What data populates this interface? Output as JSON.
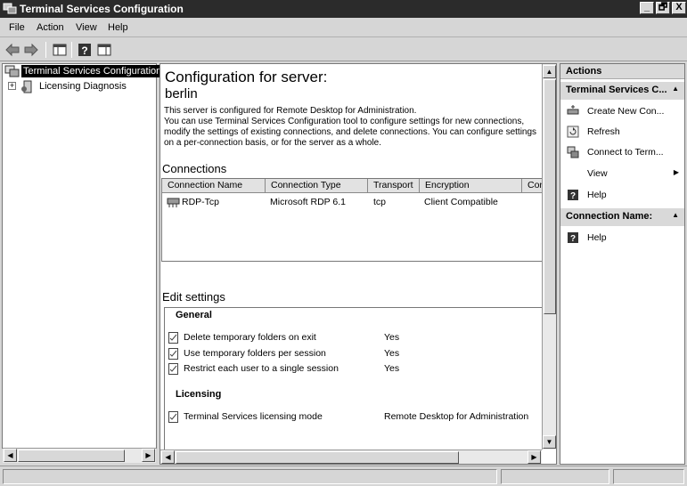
{
  "window": {
    "title": "Terminal Services Configuration",
    "controls": [
      "_",
      "🗗",
      "X"
    ]
  },
  "menu": [
    "File",
    "Action",
    "View",
    "Help"
  ],
  "toolbar": {
    "icons": [
      "back-arrow-icon",
      "forward-arrow-icon",
      "show-hide-tree-icon",
      "help-icon",
      "properties-icon"
    ]
  },
  "tree": {
    "root": "Terminal Services Configuration",
    "child": "Licensing Diagnosis"
  },
  "main": {
    "heading": "Configuration for server:",
    "server": "berlin",
    "description": "This server is configured for Remote Desktop for Administration.\nYou can use Terminal Services Configuration tool to configure settings for new connections, modify the settings of existing connections, and delete connections. You can configure settings on a per-connection basis, or for the server as a whole.",
    "connections_title": "Connections",
    "columns": [
      "Connection Name",
      "Connection Type",
      "Transport",
      "Encryption",
      "Con"
    ],
    "rows": [
      {
        "name": "RDP-Tcp",
        "type": "Microsoft RDP 6.1",
        "transport": "tcp",
        "encryption": "Client Compatible"
      }
    ],
    "edit_title": "Edit settings",
    "general_title": "General",
    "general": [
      {
        "label": "Delete temporary folders on exit",
        "value": "Yes"
      },
      {
        "label": "Use temporary folders per session",
        "value": "Yes"
      },
      {
        "label": "Restrict each user to a single session",
        "value": "Yes"
      }
    ],
    "licensing_title": "Licensing",
    "licensing": [
      {
        "label": "Terminal Services licensing mode",
        "value": "Remote Desktop for Administration"
      }
    ]
  },
  "actions": {
    "title": "Actions",
    "section1": "Terminal Services C...",
    "items1": [
      "Create New Con...",
      "Refresh",
      "Connect to Term...",
      "View",
      "Help"
    ],
    "section2": "Connection Name:",
    "items2": [
      "Help"
    ]
  },
  "colors": {
    "titlebar": "#2b2b2b",
    "selection": "#000000",
    "pane_header": "#d9d9d9"
  }
}
